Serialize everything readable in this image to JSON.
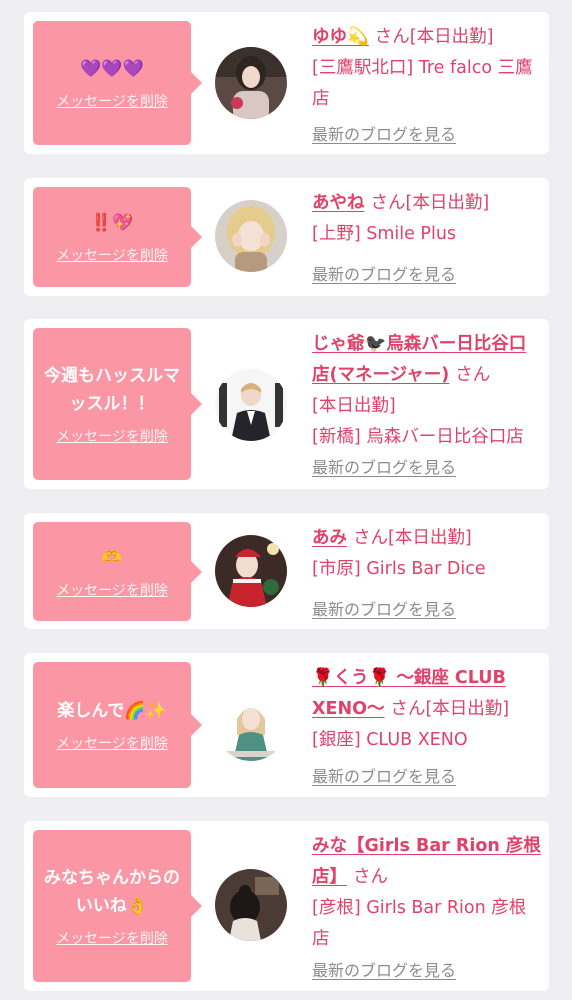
{
  "notices": [
    {
      "message": "💜💜💜",
      "delete_label": "メッセージを削除",
      "name": "ゆゆ💫",
      "san": "さん",
      "status": "[本日出勤]",
      "shop": "[三鷹駅北口] Tre falco 三鷹店",
      "blog_label": "最新のブログを見る",
      "avatar_icon": "girl-photo-avatar"
    },
    {
      "message": "‼️💖",
      "delete_label": "メッセージを削除",
      "name": "あやね",
      "san": "さん",
      "status": "[本日出勤]",
      "shop": "[上野] Smile Plus",
      "blog_label": "最新のブログを見る",
      "avatar_icon": "blonde-girl-avatar"
    },
    {
      "message": "今週もハッスルマッスル！！",
      "delete_label": "メッセージを削除",
      "name": "じゃ爺🐦‍⬛烏森バー日比谷口店(マネージャー)",
      "san": "さん",
      "status": "[本日出勤]",
      "shop": "[新橋] 烏森バー日比谷口店",
      "blog_label": "最新のブログを見る",
      "avatar_icon": "manager-suit-avatar"
    },
    {
      "message": "🫶",
      "delete_label": "メッセージを削除",
      "name": "あみ",
      "san": "さん",
      "status": "[本日出勤]",
      "shop": "[市原] Girls Bar Dice",
      "blog_label": "最新のブログを見る",
      "avatar_icon": "santa-costume-avatar"
    },
    {
      "message": "楽しんで🌈✨",
      "delete_label": "メッセージを削除",
      "name": "🌹くう🌹 〜銀座 CLUB XENO〜",
      "san": "さん",
      "status": "[本日出勤]",
      "shop": "[銀座] CLUB XENO",
      "blog_label": "最新のブログを見る",
      "avatar_icon": "green-dress-avatar"
    },
    {
      "message": "みなちゃんからのいいね👌",
      "delete_label": "メッセージを削除",
      "name": "みな【Girls Bar Rion 彦根店】",
      "san": "さん",
      "status": "",
      "shop": "[彦根] Girls Bar Rion 彦根店",
      "blog_label": "最新のブログを見る",
      "avatar_icon": "back-view-avatar"
    }
  ]
}
